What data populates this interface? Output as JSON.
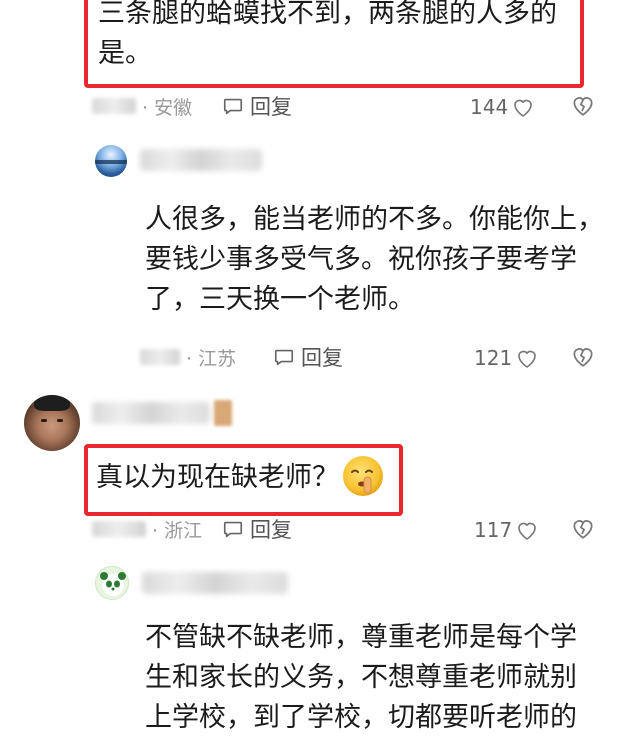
{
  "comments": [
    {
      "text": "三条腿的蛤蟆找不到，两条腿的人多的\n是。",
      "location": "· 安徽",
      "reply_label": "回复",
      "likes": "144"
    },
    {
      "text": "人很多，能当老师的不多。你能你上，\n要钱少事多受气多。祝你孩子要考学\n了，三天换一个老师。",
      "location": "· 江苏",
      "reply_label": "回复",
      "likes": "121"
    },
    {
      "text": "真以为现在缺老师？",
      "location": "· 浙江",
      "reply_label": "回复",
      "likes": "117",
      "emoji": "🤫"
    },
    {
      "text": "不管缺不缺老师，尊重老师是每个学\n生和家长的义务，不想尊重老师就别\n上学校，到了学校，切都要听老师的"
    }
  ],
  "colors": {
    "highlight": "#e8282c",
    "meta_text": "#9a9a9a",
    "body_text": "#1b1b1b"
  },
  "icons": {
    "reply": "comment-bubble-icon",
    "like": "heart-outline-icon",
    "dislike": "broken-heart-icon"
  }
}
